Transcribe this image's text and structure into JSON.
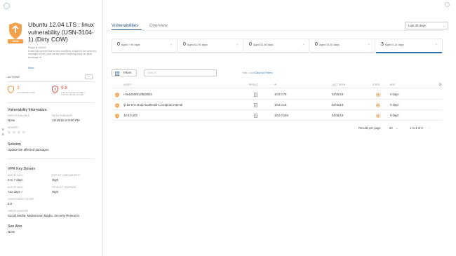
{
  "colors": {
    "accent": "#2c5a87",
    "severity_high": "#f08b2c",
    "severity_critical": "#d9413a",
    "link": "#2b7bb9"
  },
  "header": {
    "app_logo_icon": "app-logo-icon",
    "help_icon": "help-icon"
  },
  "vulnerability": {
    "severity": "HIGH",
    "title": "Ubuntu 12.04 LTS : linux vulnerability (USN-3104-1) (Dirty COW)",
    "plugin_id": "Plugin ID 94153",
    "description": "It was discovered that a race condition existed in the memory manager of the Linux kernel when handling copy-on-write breakage of",
    "more_link": "More"
  },
  "actions": {
    "label": "ACTIONS",
    "menu": "..."
  },
  "metrics": [
    {
      "value": "3",
      "label": "VULNERABILITIES"
    },
    {
      "value": "9.8",
      "label": "CVSSV3 BASE SCORE / CVSSV3 BASE SCORE"
    }
  ],
  "vuln_info": {
    "heading": "Vulnerability Information",
    "fields": [
      {
        "key": "EXPLOIT AVAILABLE",
        "value": "None"
      },
      {
        "key": "PATCH PUBLISHED",
        "value": "10/18/16 at 8:00 PM"
      },
      {
        "key": "SEVERITY",
        "value": ""
      }
    ]
  },
  "solution": {
    "heading": "Solution",
    "text": "Update the affected packages."
  },
  "vpr": {
    "heading": "VPR Key Drivers",
    "fields": [
      {
        "key": "AGE OF VULN",
        "value": "0 to 7 days"
      },
      {
        "key": "EXPLOIT CODE MATURITY",
        "value": "High"
      },
      {
        "key": "AGE OF VULN",
        "value": "731 days +"
      },
      {
        "key": "PRODUCT COVERAGE",
        "value": "High"
      },
      {
        "key": "CVSSV3 IMPACT SCORE",
        "value": "5.9"
      },
      {
        "key": "THREAT SOURCES",
        "value": "Social Media, Mainstream Media, Security Research"
      }
    ]
  },
  "see_also": {
    "heading": "See Also",
    "value": "None"
  },
  "tabs": [
    {
      "label": "Vulnerabilities",
      "active": true
    },
    {
      "label": "Overview",
      "active": false
    }
  ],
  "date_range": {
    "value": "Last 30 days"
  },
  "age_buckets": [
    {
      "count": "0",
      "label": "Aged > 90 days",
      "selected": false
    },
    {
      "count": "0",
      "label": "Aged 61-90 days",
      "selected": false
    },
    {
      "count": "0",
      "label": "Aged 31-60 days",
      "selected": false
    },
    {
      "count": "0",
      "label": "Aged 15-30 days",
      "selected": false
    },
    {
      "count": "3",
      "label": "Aged 0-14 days",
      "selected": true
    }
  ],
  "filters": {
    "button_label": "Filters",
    "search_placeholder": "Search",
    "count_text": "Filter Count: 1",
    "clear_label": "Clear All Filters"
  },
  "table": {
    "columns": [
      "ASSET",
      "RESULT",
      "IP",
      "LAST SEEN",
      "STATE",
      "AGE"
    ],
    "rows": [
      {
        "asset": "i-0e4d249513f8d3915",
        "ip": "10.0.0.78",
        "last_seen": "04/15/19",
        "age": "0 days"
      },
      {
        "asset": "ip-10-0-0-16.ap-southeast-1.compute.internal",
        "ip": "10.0.0.16",
        "last_seen": "04/15/19",
        "age": "0 days"
      },
      {
        "asset": "10.0.0.203",
        "ip": "10.0.0.203",
        "last_seen": "04/15/19",
        "age": "0 days"
      }
    ]
  },
  "pagination": {
    "label": "Results per page",
    "per_page": "50",
    "range": "1 to 3 of 3"
  }
}
